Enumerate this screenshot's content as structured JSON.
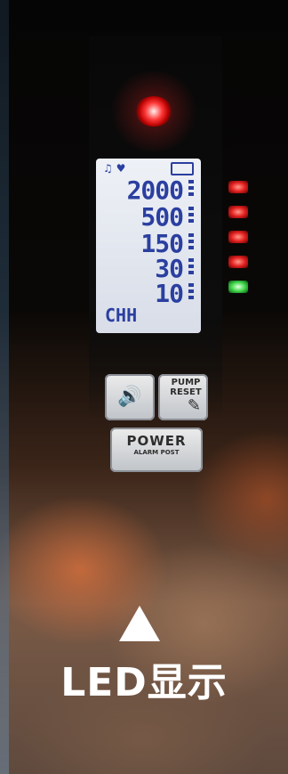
{
  "lcd": {
    "readings": [
      "2000",
      "500",
      "150",
      "30",
      "10"
    ],
    "mode": "CHH"
  },
  "buttons": {
    "pump_label": "PUMP RESET",
    "power_label": "POWER",
    "power_sub": "ALARM POST"
  },
  "indicators": [
    "red",
    "red",
    "red",
    "red",
    "green"
  ],
  "caption": "LED显示",
  "colors": {
    "lcd_digits": "#2b3fa0",
    "top_led": "#ff3a3a",
    "indicator_green": "#3fd84a"
  },
  "icons": {
    "sound_button": "speaker-icon",
    "pump_button": "wrench-bulb-icon"
  }
}
